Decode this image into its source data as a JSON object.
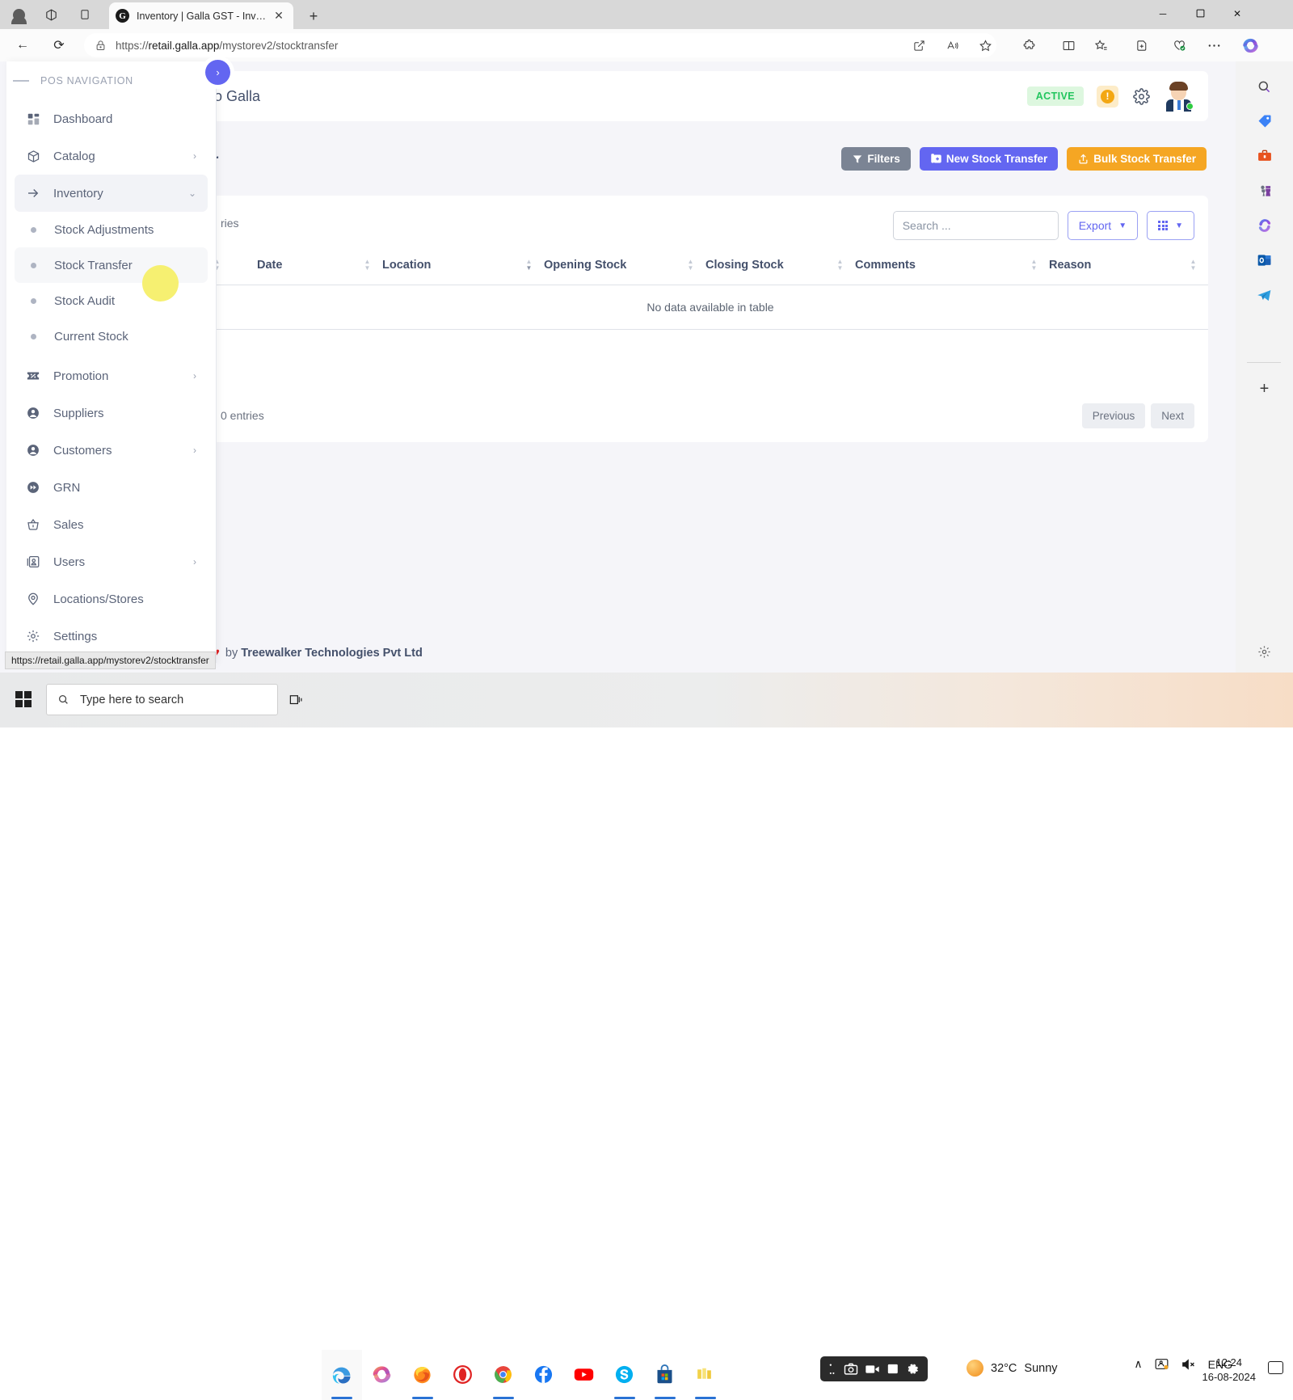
{
  "browser": {
    "tab": {
      "title": "Inventory | Galla GST - Inventory",
      "favicon_letter": "G",
      "close_label": "✕"
    },
    "newtab_label": "+",
    "window_controls": {
      "minimize": "─",
      "maximize": "☐",
      "close": "✕"
    },
    "nav": {
      "back": "←",
      "reload": "⟳"
    },
    "address": {
      "url_scheme": "https://",
      "url_domain": "retail.galla.app",
      "url_path": "/mystorev2/stocktransfer",
      "full_url": "https://retail.galla.app/mystorev2/stocktransfer"
    },
    "toolbar_icons": [
      "lock-icon",
      "open-in-app-icon",
      "read-aloud-icon",
      "favorite-star-icon",
      "extensions-icon",
      "split-screen-icon",
      "collections-icon",
      "add-to-collection-icon",
      "browser-essentials-icon",
      "settings-more-icon",
      "copilot-icon"
    ],
    "status_bar_url": "https://retail.galla.app/mystorev2/stocktransfer"
  },
  "sidebar": {
    "section_label": "POS NAVIGATION",
    "toggle_glyph": "›",
    "items": [
      {
        "label": "Dashboard",
        "icon": "dashboard-icon",
        "chevron": "",
        "active": false
      },
      {
        "label": "Catalog",
        "icon": "box-icon",
        "chevron": "›",
        "active": false
      },
      {
        "label": "Inventory",
        "icon": "arrow-right-icon",
        "chevron": "⌄",
        "active": true
      },
      {
        "label": "Promotion",
        "icon": "ticket-percent-icon",
        "chevron": "›",
        "active": false
      },
      {
        "label": "Suppliers",
        "icon": "user-circle-icon",
        "chevron": "",
        "active": false
      },
      {
        "label": "Customers",
        "icon": "user-circle-icon",
        "chevron": "›",
        "active": false
      },
      {
        "label": "GRN",
        "icon": "fast-forward-icon",
        "chevron": "",
        "active": false
      },
      {
        "label": "Sales",
        "icon": "basket-icon",
        "chevron": "",
        "active": false
      },
      {
        "label": "Users",
        "icon": "contact-card-icon",
        "chevron": "›",
        "active": false
      },
      {
        "label": "Locations/Stores",
        "icon": "map-pin-icon",
        "chevron": "",
        "active": false
      },
      {
        "label": "Settings",
        "icon": "gear-icon",
        "chevron": "",
        "active": false
      }
    ],
    "inventory_submenu": [
      {
        "label": "Stock Adjustments",
        "active": false
      },
      {
        "label": "Stock Transfer",
        "active": true
      },
      {
        "label": "Stock Audit",
        "active": false
      },
      {
        "label": "Current Stock",
        "active": false
      }
    ]
  },
  "app_header": {
    "store_name": "Demo Galla",
    "store_name_visible": "emo Galla",
    "status_badge": "ACTIVE",
    "warning_glyph": "!",
    "gear_icon": "gear-icon",
    "avatar": "user-avatar"
  },
  "toolbar": {
    "page_title_fragment": "r",
    "buttons": [
      {
        "label": "Filters",
        "icon": "funnel-icon",
        "color": "#7b8494",
        "name": "filters-button"
      },
      {
        "label": "New Stock Transfer",
        "icon": "add-copy-icon",
        "color": "#6366f1",
        "name": "new-stock-transfer-button"
      },
      {
        "label": "Bulk Stock Transfer",
        "icon": "upload-icon",
        "color": "#f5a623",
        "name": "bulk-stock-transfer-button"
      }
    ]
  },
  "card": {
    "entries_selector_fragment": "ries",
    "search": {
      "placeholder": "Search ...",
      "value": ""
    },
    "export": {
      "label": "Export",
      "caret": "▼"
    },
    "columns_button": {
      "icon": "grid-icon",
      "caret": "▼"
    },
    "table": {
      "columns": [
        "Date",
        "Location",
        "Opening Stock",
        "Closing Stock",
        "Comments",
        "Reason"
      ],
      "rows": [],
      "empty_message": "No data available in table"
    },
    "footer_info_fragment": "0 entries",
    "pagination": {
      "previous": "Previous",
      "next": "Next"
    }
  },
  "footer": {
    "heart": "♥",
    "prefix": "by ",
    "company": "Treewalker Technologies Pvt Ltd"
  },
  "taskbar": {
    "search_placeholder": "Type here to search",
    "apps": [
      "edge-icon",
      "copilot-icon",
      "firefox-icon",
      "opera-icon",
      "chrome-icon",
      "facebook-icon",
      "youtube-icon",
      "skype-icon",
      "microsoft-store-icon",
      "app-icon"
    ],
    "capture_toolbar": [
      "capture-more-icon",
      "camera-icon",
      "video-icon",
      "window-icon",
      "settings-icon"
    ],
    "weather": {
      "temperature": "32°C",
      "condition": "Sunny"
    },
    "tray": {
      "chevron": "∧",
      "onedrive": "onedrive-icon",
      "volume": "␉",
      "language": "ENG"
    },
    "clock": {
      "time": "12:24",
      "date": "16-08-2024"
    }
  },
  "colors": {
    "accent_indigo": "#6366f1",
    "accent_orange": "#f5a623",
    "accent_gray": "#7b8494",
    "active_green": "#22c55e",
    "highlight_yellow": "#f6f071"
  }
}
